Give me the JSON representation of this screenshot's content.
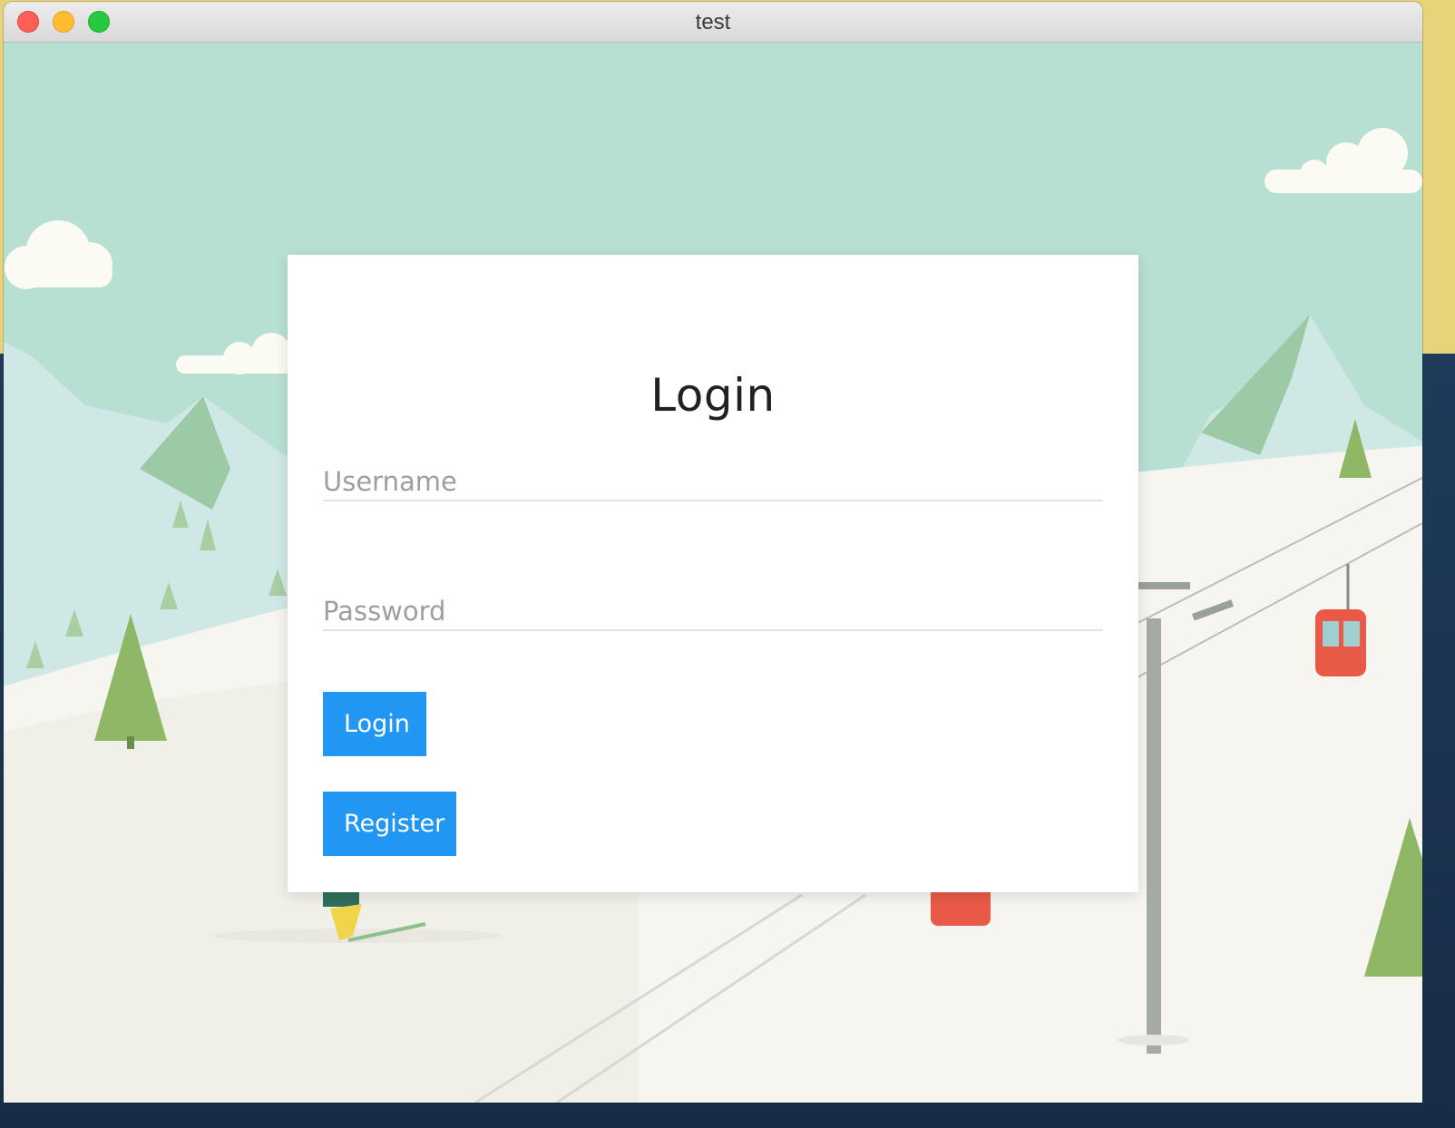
{
  "window": {
    "title": "test"
  },
  "login_form": {
    "heading": "Login",
    "username_placeholder": "Username",
    "password_placeholder": "Password",
    "login_button": "Login",
    "register_button": "Register",
    "accent_color": "#2196f3"
  },
  "background": {
    "scene": "ski-resort-illustration",
    "sky_color": "#b7e0d2",
    "snow_color": "#f6f5ef"
  }
}
